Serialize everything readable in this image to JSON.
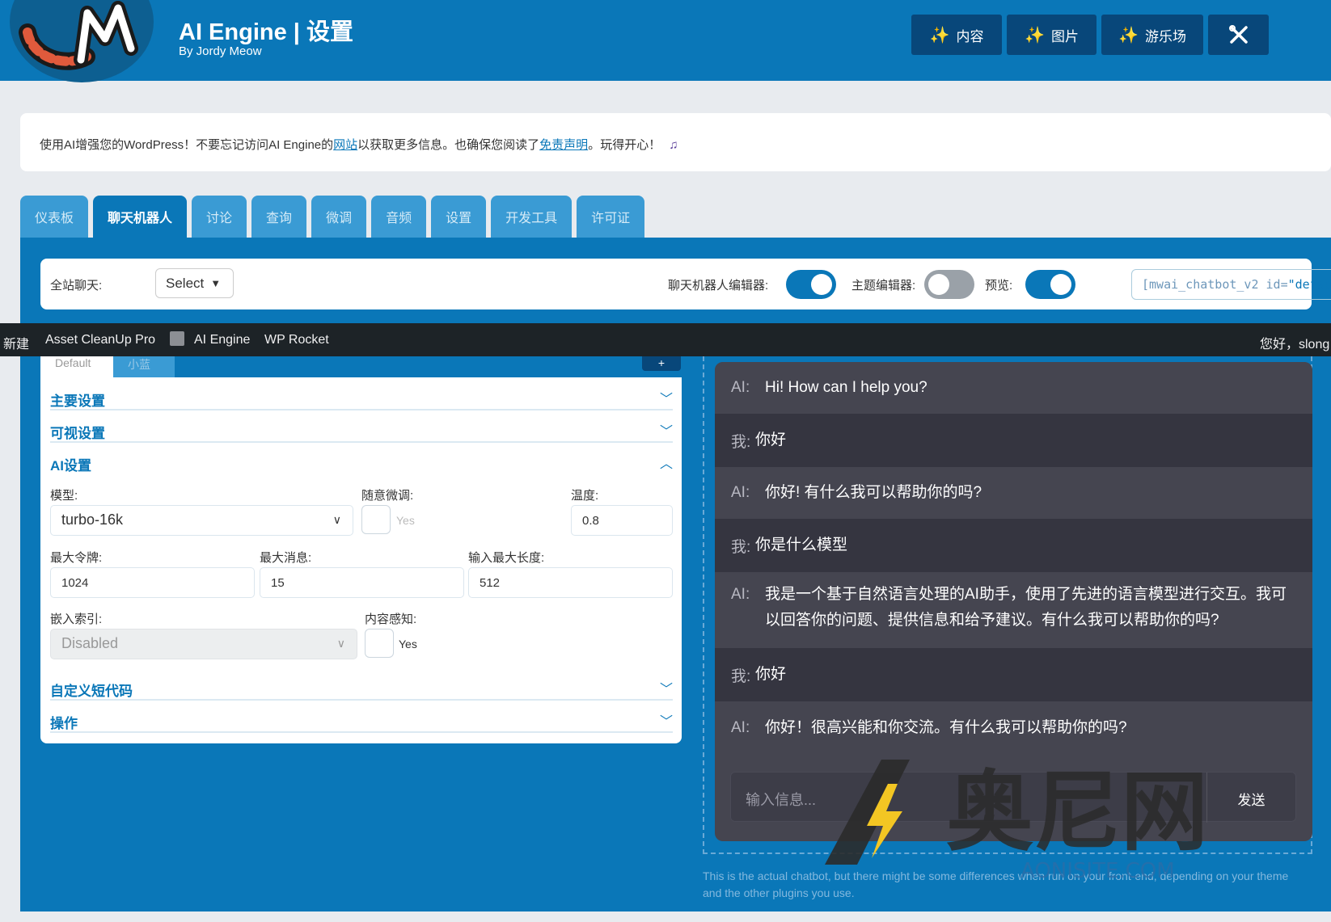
{
  "header": {
    "title": "AI Engine | 设置",
    "subtitle": "By Jordy Meow",
    "buttons": [
      {
        "label": "内容",
        "icon": "magic-wand-icon"
      },
      {
        "label": "图片",
        "icon": "magic-wand-icon"
      },
      {
        "label": "游乐场",
        "icon": "magic-wand-icon"
      },
      {
        "label": "",
        "icon": "tools-icon"
      }
    ]
  },
  "notice": {
    "before": "使用AI增强您的WordPress！不要忘记访问AI Engine的",
    "link1": "网站",
    "middle": "以获取更多信息。也确保您阅读了",
    "link2": "免责声明",
    "after": "。玩得开心！",
    "icon": "music-note-icon"
  },
  "tabs": [
    {
      "label": "仪表板",
      "active": false
    },
    {
      "label": "聊天机器人",
      "active": true
    },
    {
      "label": "讨论",
      "active": false
    },
    {
      "label": "查询",
      "active": false
    },
    {
      "label": "微调",
      "active": false
    },
    {
      "label": "音频",
      "active": false
    },
    {
      "label": "设置",
      "active": false
    },
    {
      "label": "开发工具",
      "active": false
    },
    {
      "label": "许可证",
      "active": false
    }
  ],
  "toolbar": {
    "site_chat_label": "全站聊天:",
    "site_chat_value": "Select",
    "chatbot_editor_label": "聊天机器人编辑器:",
    "chatbot_editor_on": true,
    "theme_editor_label": "主题编辑器:",
    "theme_editor_on": false,
    "preview_label": "预览:",
    "preview_on": true,
    "shortcode_prefix": "[mwai_chatbot_v2 id=",
    "shortcode_id": "\"default\"",
    "shortcode_suffix": "]"
  },
  "adminbar": {
    "new": "新建",
    "asset": "Asset CleanUp Pro",
    "ai_engine": "AI Engine",
    "wp_rocket": "WP Rocket",
    "greeting": "您好，slong"
  },
  "settings": {
    "subtabs": [
      "Default",
      "小蓝"
    ],
    "plus": "+",
    "sections": {
      "main": "主要设置",
      "visual": "可视设置",
      "ai": "AI设置",
      "shortcode": "自定义短代码",
      "actions": "操作"
    },
    "model_label": "模型:",
    "model_value": "turbo-16k",
    "casually_label": "随意微调:",
    "casually_yes": "Yes",
    "temperature_label": "温度:",
    "temperature_value": "0.8",
    "max_tokens_label": "最大令牌:",
    "max_tokens_value": "1024",
    "max_messages_label": "最大消息:",
    "max_messages_value": "15",
    "input_max_label": "输入最大长度:",
    "input_max_value": "512",
    "embeddings_label": "嵌入索引:",
    "embeddings_value": "Disabled",
    "context_label": "内容感知:",
    "context_yes": "Yes"
  },
  "chat": {
    "messages": [
      {
        "role": "ai",
        "who": "AI:",
        "text": "Hi! How can I help you?"
      },
      {
        "role": "me",
        "who": "我:",
        "text": "你好"
      },
      {
        "role": "ai",
        "who": "AI:",
        "text": "你好! 有什么我可以帮助你的吗?"
      },
      {
        "role": "me",
        "who": "我:",
        "text": "你是什么模型"
      },
      {
        "role": "ai",
        "who": "AI:",
        "text": "我是一个基于自然语言处理的AI助手，使用了先进的语言模型进行交互。我可以回答你的问题、提供信息和给予建议。有什么我可以帮助你的吗?"
      },
      {
        "role": "me",
        "who": "我:",
        "text": "你好"
      },
      {
        "role": "ai",
        "who": "AI:",
        "text": "你好！很高兴能和你交流。有什么我可以帮助你的吗?"
      }
    ],
    "placeholder": "输入信息...",
    "send": "发送",
    "footnote": "This is the actual chatbot, but there might be some differences when run on your front-end, depending on your theme and the other plugins you use."
  },
  "watermark": {
    "text": "奥尼网",
    "url": "AONISITE.COM"
  },
  "colors": {
    "brand": "#0a77b8",
    "dark_button": "#08477a",
    "chat_ai": "#454550",
    "chat_me": "#353540"
  }
}
